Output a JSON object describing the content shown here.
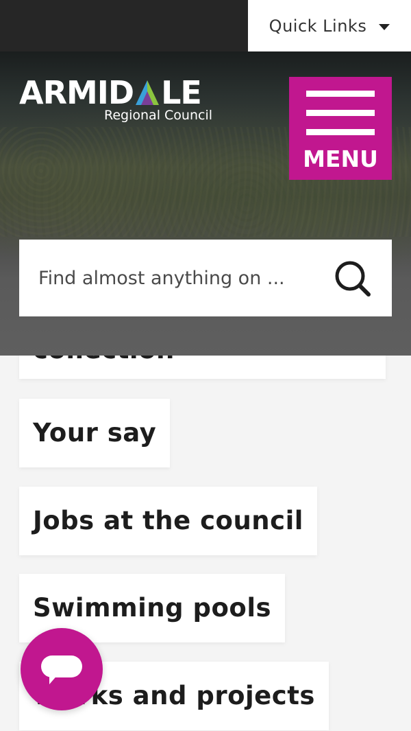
{
  "topbar": {
    "quick_links_label": "Quick Links"
  },
  "header": {
    "logo_text_left": "ARMID",
    "logo_text_right": "LE",
    "logo_subtitle": "Regional Council",
    "menu_label": "MENU"
  },
  "search": {
    "placeholder": "Find almost anything on ..."
  },
  "tiles": [
    {
      "label": "collection"
    },
    {
      "label": "Your say"
    },
    {
      "label": "Jobs at the council"
    },
    {
      "label": "Swimming pools"
    },
    {
      "label": "Works and projects"
    }
  ],
  "colors": {
    "accent": "#c1178f",
    "topbar_bg": "#262626",
    "page_bg": "#f4f4f4"
  },
  "icons": {
    "quick_links": "chevron-down-icon",
    "menu": "hamburger-icon",
    "search": "search-icon",
    "chat": "chat-bubble-icon"
  }
}
